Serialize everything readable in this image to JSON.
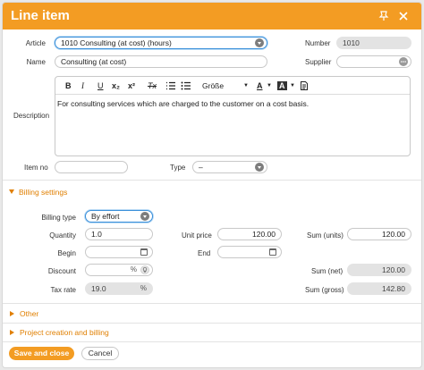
{
  "dialog": {
    "title": "Line item"
  },
  "article": {
    "label": "Article",
    "value": "1010 Consulting (at cost) (hours)"
  },
  "number": {
    "label": "Number",
    "value": "1010"
  },
  "name": {
    "label": "Name",
    "value": "Consulting (at cost)"
  },
  "supplier": {
    "label": "Supplier",
    "value": ""
  },
  "description": {
    "label": "Description",
    "text": "For consulting services which are charged to the customer on a cost basis.",
    "toolbar": {
      "bold": "B",
      "italic": "I",
      "underline": "U",
      "subscript": "x₂",
      "superscript": "x²",
      "clear_format": "Tx",
      "font_size": "Größe",
      "text_color": "A",
      "bg_color": "A"
    }
  },
  "item_no": {
    "label": "Item no",
    "value": ""
  },
  "type": {
    "label": "Type",
    "value": "–"
  },
  "billing": {
    "section": "Billing settings",
    "billing_type": {
      "label": "Billing type",
      "value": "By effort"
    },
    "quantity": {
      "label": "Quantity",
      "value": "1.0"
    },
    "unit_price": {
      "label": "Unit price",
      "value": "120.00"
    },
    "sum_units": {
      "label": "Sum (units)",
      "value": "120.00"
    },
    "begin": {
      "label": "Begin",
      "value": ""
    },
    "end": {
      "label": "End",
      "value": ""
    },
    "discount": {
      "label": "Discount",
      "value": "",
      "suffix": "%"
    },
    "sum_net": {
      "label": "Sum (net)",
      "value": "120.00"
    },
    "tax_rate": {
      "label": "Tax rate",
      "value": "19.0",
      "suffix": "%"
    },
    "sum_gross": {
      "label": "Sum (gross)",
      "value": "142.80"
    }
  },
  "sections": {
    "other": "Other",
    "project": "Project creation and billing"
  },
  "footer": {
    "save_label": "Save and close",
    "cancel_label": "Cancel"
  },
  "colors": {
    "accent": "#f39c23",
    "focus": "#3a8fd9"
  }
}
